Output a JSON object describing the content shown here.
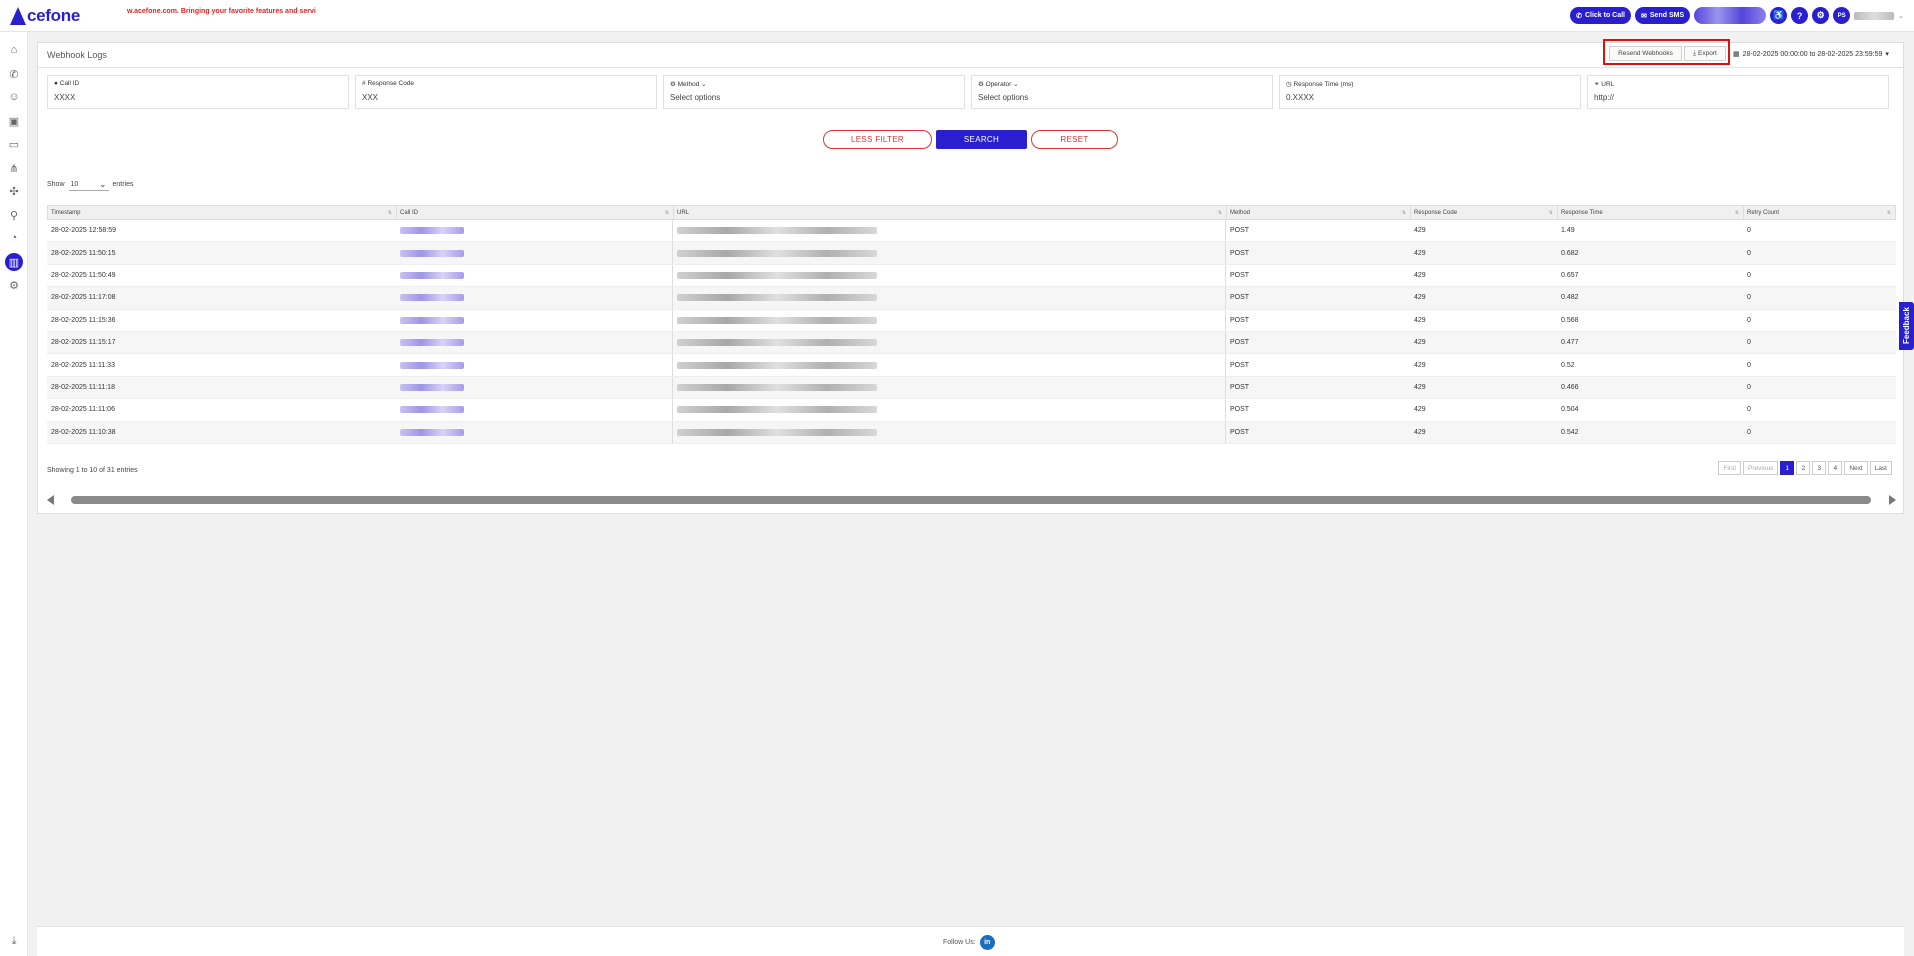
{
  "header": {
    "logo_text": "cefone",
    "marquee": "w.acefone.com. Bringing your favorite features and servi",
    "click_to_call": "Click to Call",
    "send_sms": "Send SMS",
    "avatar_initials": "PS"
  },
  "page": {
    "title": "Webhook Logs",
    "resend_label": "Resend Webhooks",
    "export_label": "Export",
    "date_range": "28-02-2025 00:00:00 to 28-02-2025 23:59:59"
  },
  "filters": [
    {
      "label": "Call ID",
      "value": "XXXX",
      "icon": "user-icon"
    },
    {
      "label": "Response Code",
      "value": "XXX",
      "icon": "code-icon"
    },
    {
      "label": "Method",
      "value": "Select options",
      "icon": "settings-icon"
    },
    {
      "label": "Operator",
      "value": "Select options",
      "icon": "settings-icon"
    },
    {
      "label": "Response Time (ms)",
      "value": "0.XXXX",
      "icon": "clock-icon"
    },
    {
      "label": "URL",
      "value": "http://",
      "icon": "link-icon"
    }
  ],
  "buttons": {
    "less_filter": "LESS FILTER",
    "search": "SEARCH",
    "reset": "RESET"
  },
  "table": {
    "show_label": "Show",
    "entries_label": "entries",
    "page_size": "10",
    "columns": [
      "Timestamp",
      "Call ID",
      "URL",
      "Method",
      "Response Code",
      "Response Time",
      "Retry Count"
    ],
    "rows": [
      {
        "timestamp": "28-02-2025 12:58:59",
        "method": "POST",
        "code": "429",
        "time": "1.49",
        "retry": "0"
      },
      {
        "timestamp": "28-02-2025 11:50:15",
        "method": "POST",
        "code": "429",
        "time": "0.682",
        "retry": "0"
      },
      {
        "timestamp": "28-02-2025 11:50:49",
        "method": "POST",
        "code": "429",
        "time": "0.657",
        "retry": "0"
      },
      {
        "timestamp": "28-02-2025 11:17:08",
        "method": "POST",
        "code": "429",
        "time": "0.482",
        "retry": "0"
      },
      {
        "timestamp": "28-02-2025 11:15:36",
        "method": "POST",
        "code": "429",
        "time": "0.568",
        "retry": "0"
      },
      {
        "timestamp": "28-02-2025 11:15:17",
        "method": "POST",
        "code": "429",
        "time": "0.477",
        "retry": "0"
      },
      {
        "timestamp": "28-02-2025 11:11:33",
        "method": "POST",
        "code": "429",
        "time": "0.52",
        "retry": "0"
      },
      {
        "timestamp": "28-02-2025 11:11:18",
        "method": "POST",
        "code": "429",
        "time": "0.466",
        "retry": "0"
      },
      {
        "timestamp": "28-02-2025 11:11:06",
        "method": "POST",
        "code": "429",
        "time": "0.504",
        "retry": "0"
      },
      {
        "timestamp": "28-02-2025 11:10:38",
        "method": "POST",
        "code": "429",
        "time": "0.542",
        "retry": "0"
      }
    ],
    "info": "Showing 1 to 10 of 31 entries"
  },
  "pagination": {
    "first": "First",
    "previous": "Previous",
    "pages": [
      "1",
      "2",
      "3",
      "4"
    ],
    "next": "Next",
    "last": "Last"
  },
  "feedback_label": "Feedback",
  "footer": {
    "follow_us": "Follow Us:",
    "linkedin": "in"
  },
  "colors": {
    "brand": "#2a1fcf",
    "brand_green": "#21a94a",
    "danger": "#d33333"
  }
}
